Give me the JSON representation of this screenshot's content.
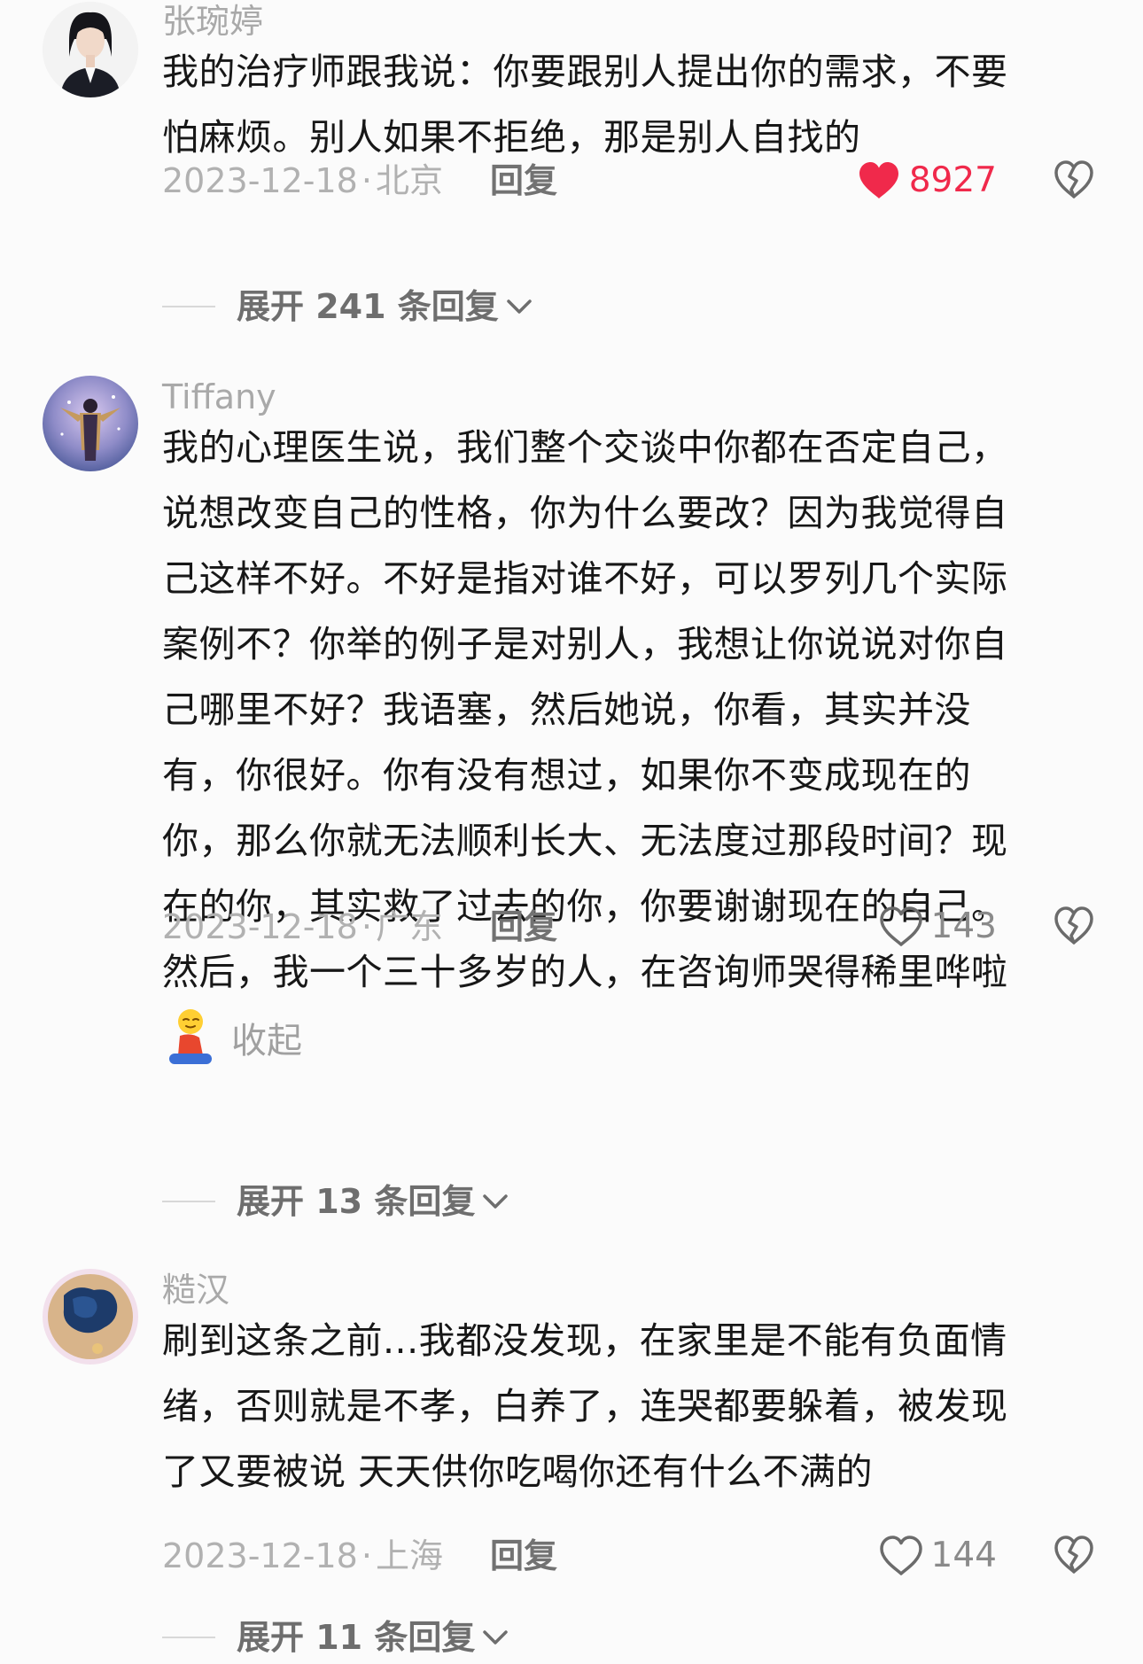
{
  "comments": [
    {
      "username": "张琬婷",
      "content_lines": [
        "我的治疗师跟我说：你要跟别人提出你的需求，不要",
        "怕麻烦。别人如果不拒绝，那是别人自找的"
      ],
      "date": "2023-12-18",
      "location": "北京",
      "reply_label": "回复",
      "likes": "8927",
      "liked": true,
      "expand_label": "展开 241 条回复"
    },
    {
      "username": "Tiffany",
      "content_lines": [
        "我的心理医生说，我们整个交谈中你都在否定自己，",
        "说想改变自己的性格，你为什么要改？因为我觉得自",
        "己这样不好。不好是指对谁不好，可以罗列几个实际",
        "案例不？你举的例子是对别人，我想让你说说对你自",
        "己哪里不好？我语塞，然后她说，你看，其实并没",
        "有，你很好。你有没有想过，如果你不变成现在的",
        "你，那么你就无法顺利长大、无法度过那段时间？现",
        "在的你，其实救了过去的你，你要谢谢现在的自己。",
        "然后，我一个三十多岁的人，在咨询师哭得稀里哗啦"
      ],
      "collapse_label": "收起",
      "date": "2023-12-18",
      "location": "广东",
      "reply_label": "回复",
      "likes": "143",
      "liked": false,
      "expand_label": "展开 13 条回复"
    },
    {
      "username": "糙汉",
      "content_lines": [
        "刷到这条之前...我都没发现，在家里是不能有负面情",
        "绪，否则就是不孝，白养了，连哭都要躲着，被发现",
        "了又要被说 天天供你吃喝你还有什么不满的"
      ],
      "date": "2023-12-18",
      "location": "上海",
      "reply_label": "回复",
      "likes": "144",
      "liked": false,
      "expand_label": "展开 11 条回复"
    }
  ],
  "meta_separator": "·",
  "colors": {
    "like_active": "#f0294b",
    "like_inactive": "#8a8a8a",
    "username": "#a9a9a9",
    "body_text": "#171717"
  },
  "icons": {
    "like": "heart-icon",
    "dislike": "broken-heart-icon",
    "expand": "chevron-down-icon",
    "emoji": "kneeling-emoji-icon"
  }
}
